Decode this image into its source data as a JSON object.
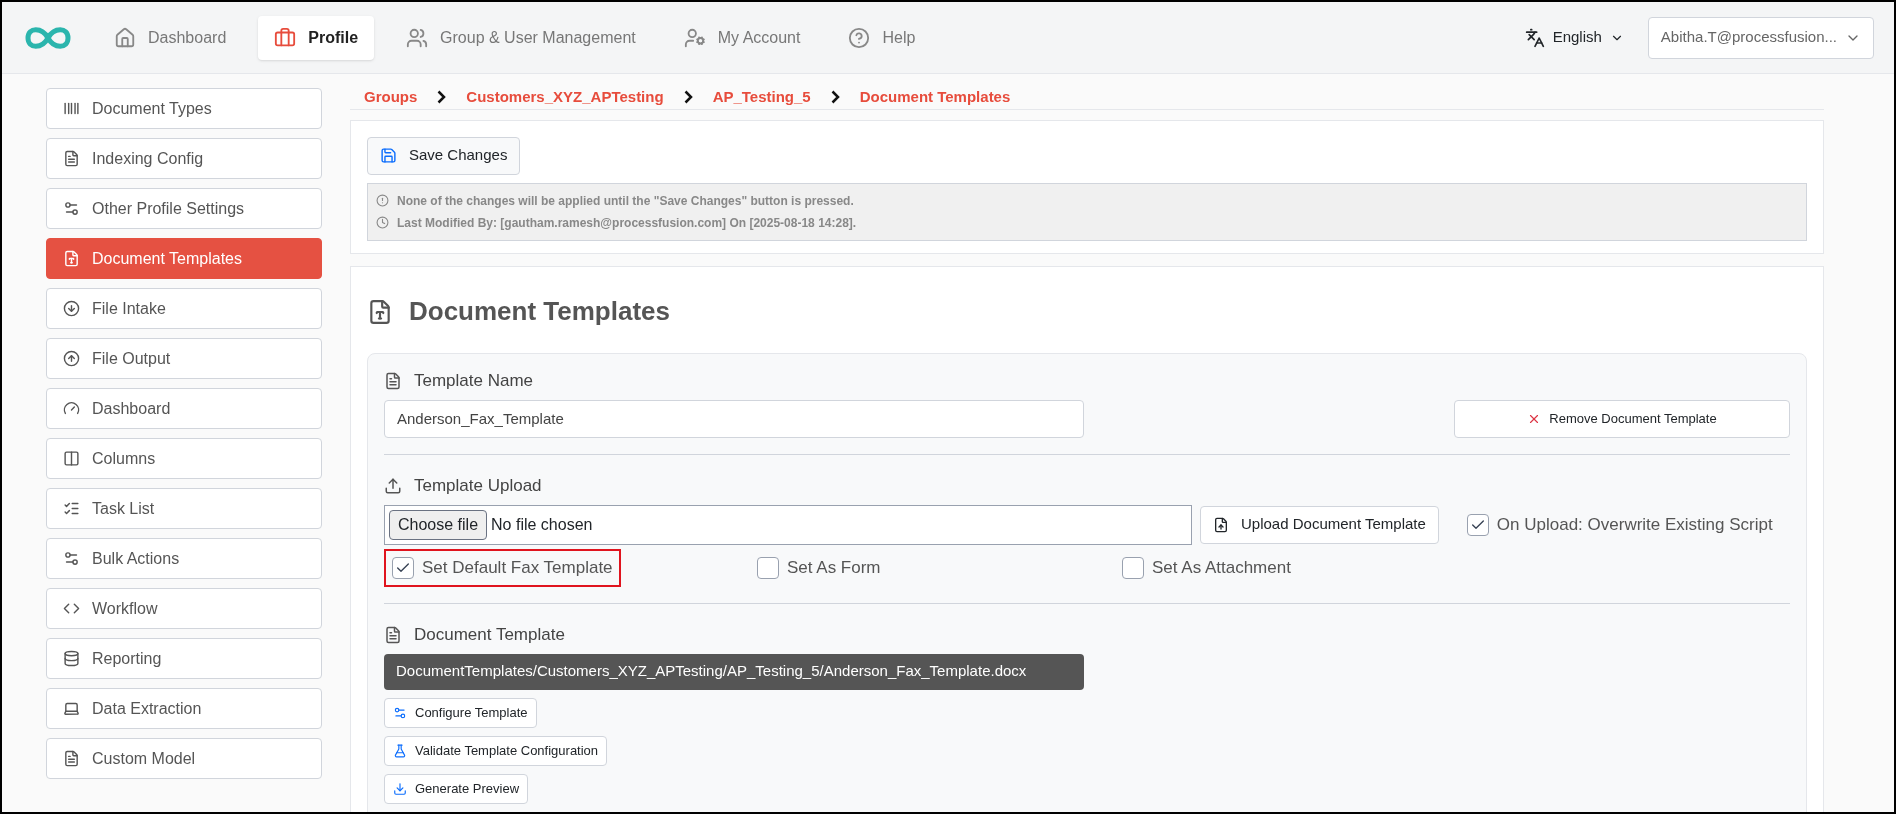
{
  "nav": {
    "tabs": [
      {
        "label": "Dashboard",
        "selected": false
      },
      {
        "label": "Profile",
        "selected": true
      },
      {
        "label": "Group & User Management",
        "selected": false
      },
      {
        "label": "My Account",
        "selected": false
      },
      {
        "label": "Help",
        "selected": false
      }
    ],
    "language": "English",
    "user": "Abitha.T@processfusion..."
  },
  "sidebar": {
    "items": [
      {
        "label": "Document Types",
        "selected": false
      },
      {
        "label": "Indexing Config",
        "selected": false
      },
      {
        "label": "Other Profile Settings",
        "selected": false
      },
      {
        "label": "Document Templates",
        "selected": true
      },
      {
        "label": "File Intake",
        "selected": false
      },
      {
        "label": "File Output",
        "selected": false
      },
      {
        "label": "Dashboard",
        "selected": false
      },
      {
        "label": "Columns",
        "selected": false
      },
      {
        "label": "Task List",
        "selected": false
      },
      {
        "label": "Bulk Actions",
        "selected": false
      },
      {
        "label": "Workflow",
        "selected": false
      },
      {
        "label": "Reporting",
        "selected": false
      },
      {
        "label": "Data Extraction",
        "selected": false
      },
      {
        "label": "Custom Model",
        "selected": false
      }
    ]
  },
  "breadcrumb": [
    "Groups",
    "Customers_XYZ_APTesting",
    "AP_Testing_5",
    "Document Templates"
  ],
  "save_panel": {
    "button": "Save Changes",
    "notes": [
      "None of the changes will be applied until the \"Save Changes\" button is pressed.",
      "Last Modified By: [gautham.ramesh@processfusion.com] On [2025-08-18 14:28]."
    ]
  },
  "section": {
    "title": "Document Templates",
    "template_name": {
      "label": "Template Name",
      "value": "Anderson_Fax_Template"
    },
    "remove_button": "Remove Document Template",
    "upload": {
      "label": "Template Upload",
      "choose_button": "Choose file",
      "file_status": "No file chosen",
      "upload_button": "Upload Document Template"
    },
    "overwrite": {
      "label": "On Upload: Overwrite Existing Script",
      "checked": true
    },
    "checkboxes": [
      {
        "label": "Set Default Fax Template",
        "checked": true,
        "highlighted": true
      },
      {
        "label": "Set As Form",
        "checked": false,
        "highlighted": false
      },
      {
        "label": "Set As Attachment",
        "checked": false,
        "highlighted": false
      }
    ],
    "document_template": {
      "label": "Document Template",
      "path": "DocumentTemplates/Customers_XYZ_APTesting/AP_Testing_5/Anderson_Fax_Template.docx"
    },
    "actions": [
      "Configure Template",
      "Validate Template Configuration",
      "Generate Preview"
    ]
  }
}
